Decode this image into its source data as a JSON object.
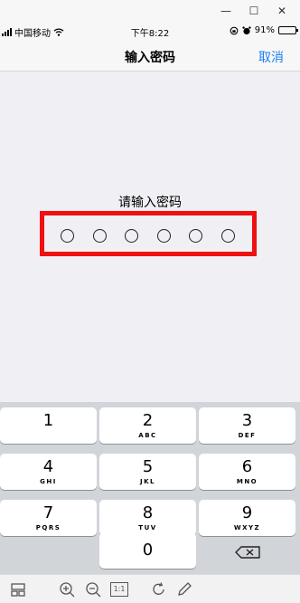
{
  "window": {
    "minimize_label": "—",
    "maximize_label": "☐",
    "close_label": "✕"
  },
  "status_bar": {
    "carrier": "中国移动",
    "time": "下午8:22",
    "battery_percent": "91%",
    "battery_level": 0.91
  },
  "nav": {
    "title": "输入密码",
    "cancel_label": "取消"
  },
  "passcode": {
    "prompt": "请输入密码",
    "length": 6,
    "entered": 0
  },
  "keypad": {
    "keys": [
      {
        "num": "1",
        "letters": ""
      },
      {
        "num": "2",
        "letters": "ABC"
      },
      {
        "num": "3",
        "letters": "DEF"
      },
      {
        "num": "4",
        "letters": "GHI"
      },
      {
        "num": "5",
        "letters": "JKL"
      },
      {
        "num": "6",
        "letters": "MNO"
      },
      {
        "num": "7",
        "letters": "PQRS"
      },
      {
        "num": "8",
        "letters": "TUV"
      },
      {
        "num": "9",
        "letters": "WXYZ"
      },
      {
        "num": "0",
        "letters": ""
      }
    ]
  },
  "toolbar": {
    "actual_size_label": "1:1"
  },
  "colors": {
    "accent": "#1a7ef5",
    "highlight": "#ee1111",
    "keypad_bg": "#d1d4d9"
  }
}
